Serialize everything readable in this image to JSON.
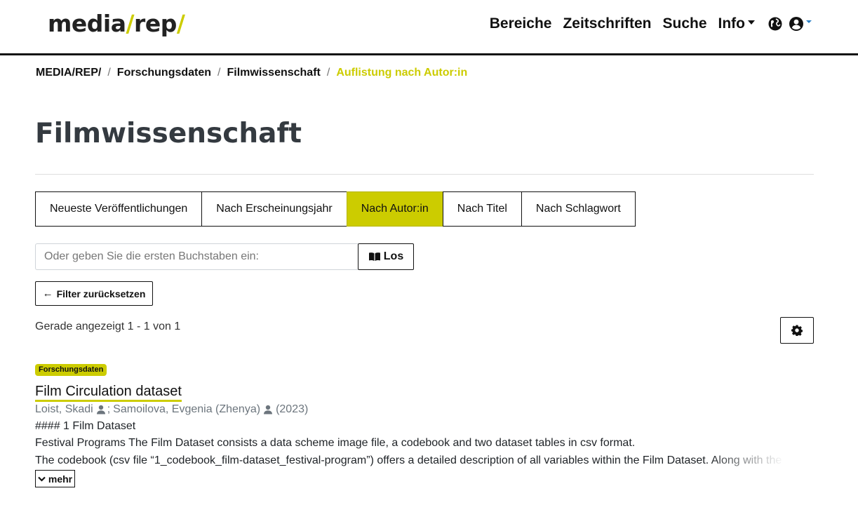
{
  "header": {
    "logo": {
      "part1": "media",
      "slash1": "/",
      "part2": "rep",
      "slash2": "/"
    },
    "nav": [
      "Bereiche",
      "Zeitschriften",
      "Suche",
      "Info"
    ],
    "icons": [
      "globe-icon",
      "user-icon"
    ]
  },
  "breadcrumb": {
    "items": [
      "MEDIA/REP/",
      "Forschungsdaten",
      "Filmwissenschaft"
    ],
    "current": "Auflistung nach Autor:in",
    "separator": "/"
  },
  "page": {
    "title": "Filmwissenschaft"
  },
  "tabs": [
    {
      "label": "Neueste Veröffentlichungen",
      "active": false
    },
    {
      "label": "Nach Erscheinungsjahr",
      "active": false
    },
    {
      "label": "Nach Autor:in",
      "active": true
    },
    {
      "label": "Nach Titel",
      "active": false
    },
    {
      "label": "Nach Schlagwort",
      "active": false
    }
  ],
  "search": {
    "placeholder": "Oder geben Sie die ersten Buchstaben ein:",
    "value": "",
    "button": "Los"
  },
  "reset": {
    "label": "Filter zurücksetzen"
  },
  "results": {
    "status": "Gerade angezeigt 1 - 1 von 1"
  },
  "item": {
    "badge": "Forschungsdaten",
    "title": "Film Circulation dataset",
    "author1": "Loist, Skadi",
    "sep": ";",
    "author2": "Samoilova, Evgenia (Zhenya)",
    "year": "(2023)",
    "line1": "#### 1 Film Dataset",
    "line2": "Festival Programs The Film Dataset consists a data scheme image file, a codebook and two dataset tables in csv format.",
    "line3": "The codebook (csv file “1_codebook_film-dataset_festival-program”) offers a detailed description of all variables within the Film Dataset. Along with the",
    "more": "mehr"
  },
  "colors": {
    "accent": "#cccc00",
    "text": "#212529",
    "muted": "#6c757d",
    "border": "#111111"
  }
}
